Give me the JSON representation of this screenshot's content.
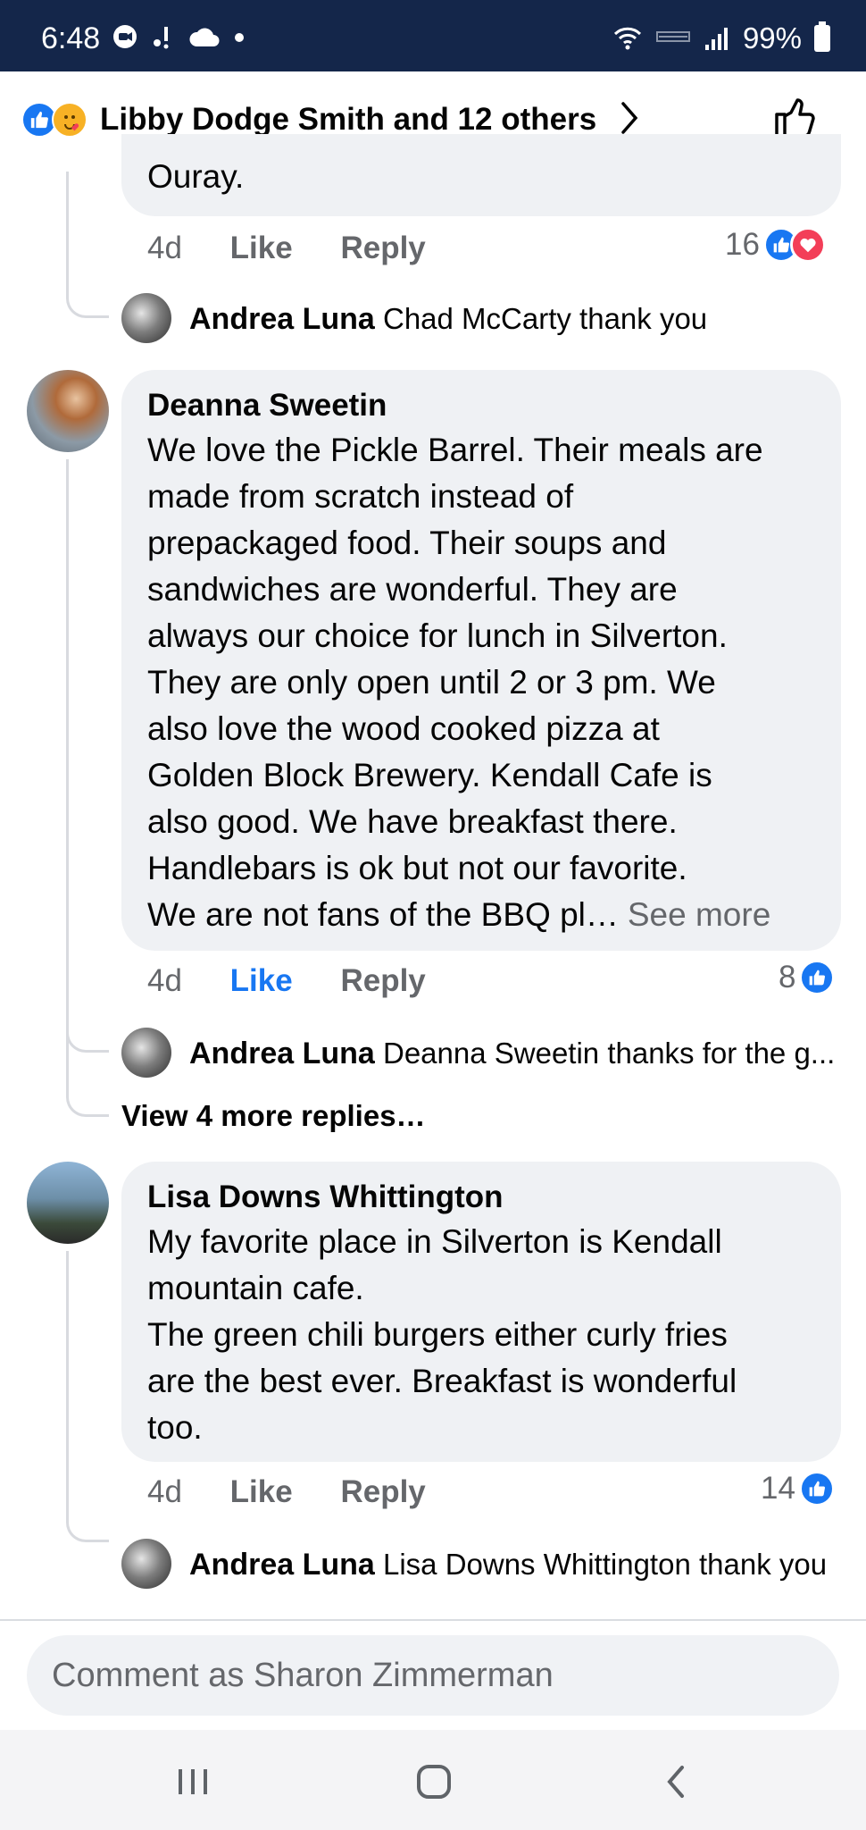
{
  "status_bar": {
    "time": "6:48",
    "battery": "99%"
  },
  "reactions_header": {
    "text": "Libby Dodge Smith and 12 others"
  },
  "comments": [
    {
      "text_tail": "Ouray.",
      "age": "4d",
      "like_label": "Like",
      "reply_label": "Reply",
      "reaction_count": "16",
      "reply": {
        "author": "Andrea Luna",
        "text": "Chad McCarty thank you"
      }
    },
    {
      "author": "Deanna Sweetin",
      "text": "We love the Pickle Barrel. Their meals are\nmade from scratch instead of\nprepackaged food. Their soups and\nsandwiches are wonderful. They are\nalways our choice for lunch in Silverton.\nThey are only open until 2 or 3 pm. We\nalso love the wood cooked pizza at\nGolden Block Brewery. Kendall Cafe is\nalso good. We have breakfast there.\nHandlebars is ok but not our favorite.\nWe are not fans of the BBQ pl…",
      "see_more": "See more",
      "age": "4d",
      "like_label": "Like",
      "reply_label": "Reply",
      "reaction_count": "8",
      "reply": {
        "author": "Andrea Luna",
        "text": "Deanna Sweetin thanks for the g..."
      },
      "more_replies": "View 4 more replies…"
    },
    {
      "author": "Lisa Downs Whittington",
      "text": "My favorite place in Silverton is Kendall\nmountain cafe.\nThe green chili burgers either curly fries\nare the best ever. Breakfast is wonderful\ntoo.",
      "age": "4d",
      "like_label": "Like",
      "reply_label": "Reply",
      "reaction_count": "14",
      "reply": {
        "author": "Andrea Luna",
        "text": "Lisa Downs Whittington thank you"
      }
    }
  ],
  "composer": {
    "placeholder": "Comment as Sharon Zimmerman"
  },
  "colors": {
    "status_bar": "#14264a",
    "like_blue": "#1877f2",
    "bubble": "#eff1f4",
    "secondary_text": "#65676b"
  }
}
